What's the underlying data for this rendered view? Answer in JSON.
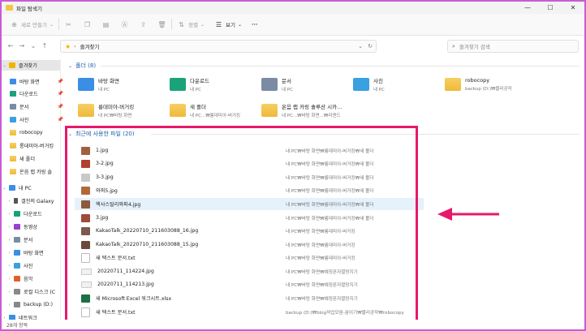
{
  "window": {
    "title": "파일 탐색기",
    "controls": [
      "—",
      "☐",
      "✕"
    ]
  },
  "commandbar": {
    "new_label": "새로 만들기",
    "sort_label": "정렬",
    "view_label": "보기",
    "more_label": "···"
  },
  "address": {
    "crumb": "즐겨찾기",
    "dropdown": "⌄",
    "refresh": "↻"
  },
  "search": {
    "placeholder": "즐겨찾기 검색"
  },
  "sidebar": {
    "items": [
      {
        "label": "즐겨찾기",
        "color": "#f2b400"
      },
      {
        "label": "바탕 화면",
        "color": "#3a8ee6"
      },
      {
        "label": "다운로드",
        "color": "#1aa37a"
      },
      {
        "label": "문서",
        "color": "#7b8ba3"
      },
      {
        "label": "사진",
        "color": "#3aa0e0"
      },
      {
        "label": "robocopy",
        "color": "#f0c24a"
      },
      {
        "label": "롱데미아-버거킹",
        "color": "#f0c24a"
      },
      {
        "label": "새 폴더",
        "color": "#f0c24a"
      },
      {
        "label": "온음 랩 카링 솔",
        "color": "#f0c24a"
      },
      {
        "label": "내 PC",
        "color": "#3a8ee6"
      },
      {
        "label": "갤진의 Galaxy",
        "color": "#555555"
      },
      {
        "label": "다운로드",
        "color": "#1aa37a"
      },
      {
        "label": "동영상",
        "color": "#9b3fcf"
      },
      {
        "label": "문서",
        "color": "#7b8ba3"
      },
      {
        "label": "바탕 화면",
        "color": "#3a8ee6"
      },
      {
        "label": "사진",
        "color": "#3aa0e0"
      },
      {
        "label": "음악",
        "color": "#e35d2a"
      },
      {
        "label": "로컬 디스크 (C",
        "color": "#888888"
      },
      {
        "label": "backup (D:)",
        "color": "#888888"
      },
      {
        "label": "네트워크",
        "color": "#3a8ee6"
      }
    ]
  },
  "folders": {
    "header": "폴더 (8)",
    "tiles": [
      {
        "name": "바탕 화면",
        "sub": "내 PC",
        "color": "#3a8ee6"
      },
      {
        "name": "다운로드",
        "sub": "내 PC",
        "color": "#1aa37a"
      },
      {
        "name": "문서",
        "sub": "내 PC",
        "color": "#7b8ba3"
      },
      {
        "name": "사진",
        "sub": "내 PC",
        "color": "#3aa0e0"
      },
      {
        "name": "robocopy",
        "sub": "backup (D:)₩블리공작",
        "color": "#f0c24a"
      },
      {
        "name": "롱데미아-버거킹",
        "sub": "내 PC₩바탕 화면",
        "color": "#f0c24a"
      },
      {
        "name": "새 폴더",
        "sub": "내 PC...₩롱데미아-버거킹",
        "color": "#f0c24a"
      },
      {
        "name": "온음 랩 카링 솔루션 시카...",
        "sub": "내 PC...₩바탕 화면...₩리엔드",
        "color": "#f0c24a"
      }
    ]
  },
  "recent": {
    "header": "최근에 사용한 파일 (20)",
    "rows": [
      {
        "name": "1.jpg",
        "loc": "내 PC₩바탕 화면₩롱데미아-버거킹₩새 폴더",
        "color": "#a06040"
      },
      {
        "name": "3-2.jpg",
        "loc": "내 PC₩바탕 화면₩롱데미아-버거킹₩새 폴더",
        "color": "#b04030"
      },
      {
        "name": "3-3.jpg",
        "loc": "내 PC₩바탕 화면₩롱데미아-버거킹₩새 폴더",
        "color": "#c9c9c9"
      },
      {
        "name": "와퍼5.jpg",
        "loc": "내 PC₩바탕 화면₩롱데미아-버거킹₩새 폴더",
        "color": "#b06a3a"
      },
      {
        "name": "핵사스탈리와퍼4.jpg",
        "loc": "내 PC₩바탕 화면₩롱데미아-버거킹₩새 폴더",
        "color": "#8a5a3a"
      },
      {
        "name": "3.jpg",
        "loc": "내 PC₩바탕 화면₩롱데미아-버거킹₩새 폴더",
        "color": "#a04a3a"
      },
      {
        "name": "KakaoTalk_20220710_211603088_16.jpg",
        "loc": "내 PC₩바탕 화면₩롱데미아-버거킹",
        "color": "#7a5a4a"
      },
      {
        "name": "KakaoTalk_20220710_211603088_15.jpg",
        "loc": "내 PC₩바탕 화면₩롱데미아-버거킹",
        "color": "#6a4a3a"
      },
      {
        "name": "새 텍스트 문서.txt",
        "loc": "내 PC₩바탕 화면₩롱데미아-버거킹",
        "color": "#dddddd"
      },
      {
        "name": "20220711_114224.jpg",
        "loc": "내 PC₩바탕 화면₩예정폰자멸망지기",
        "color": "#eeeeee"
      },
      {
        "name": "20220711_114213.jpg",
        "loc": "내 PC₩바탕 화면₩예정폰자멸망지기",
        "color": "#eeeeee"
      },
      {
        "name": "새 Microsoft Excel 워크시트.xlsx",
        "loc": "내 PC₩바탕 화면₩예정폰자멸망지기",
        "color": "#1d7044"
      },
      {
        "name": "새 텍스트 문서.txt",
        "loc": "backup (D:)₩blog작업모음-꿈이기₩블리공작₩robocopy",
        "color": "#dddddd"
      }
    ]
  },
  "annotation": {
    "arrow_color": "#e7196b",
    "box_color": "#e7196b"
  },
  "status": {
    "count": "28개 항목"
  }
}
